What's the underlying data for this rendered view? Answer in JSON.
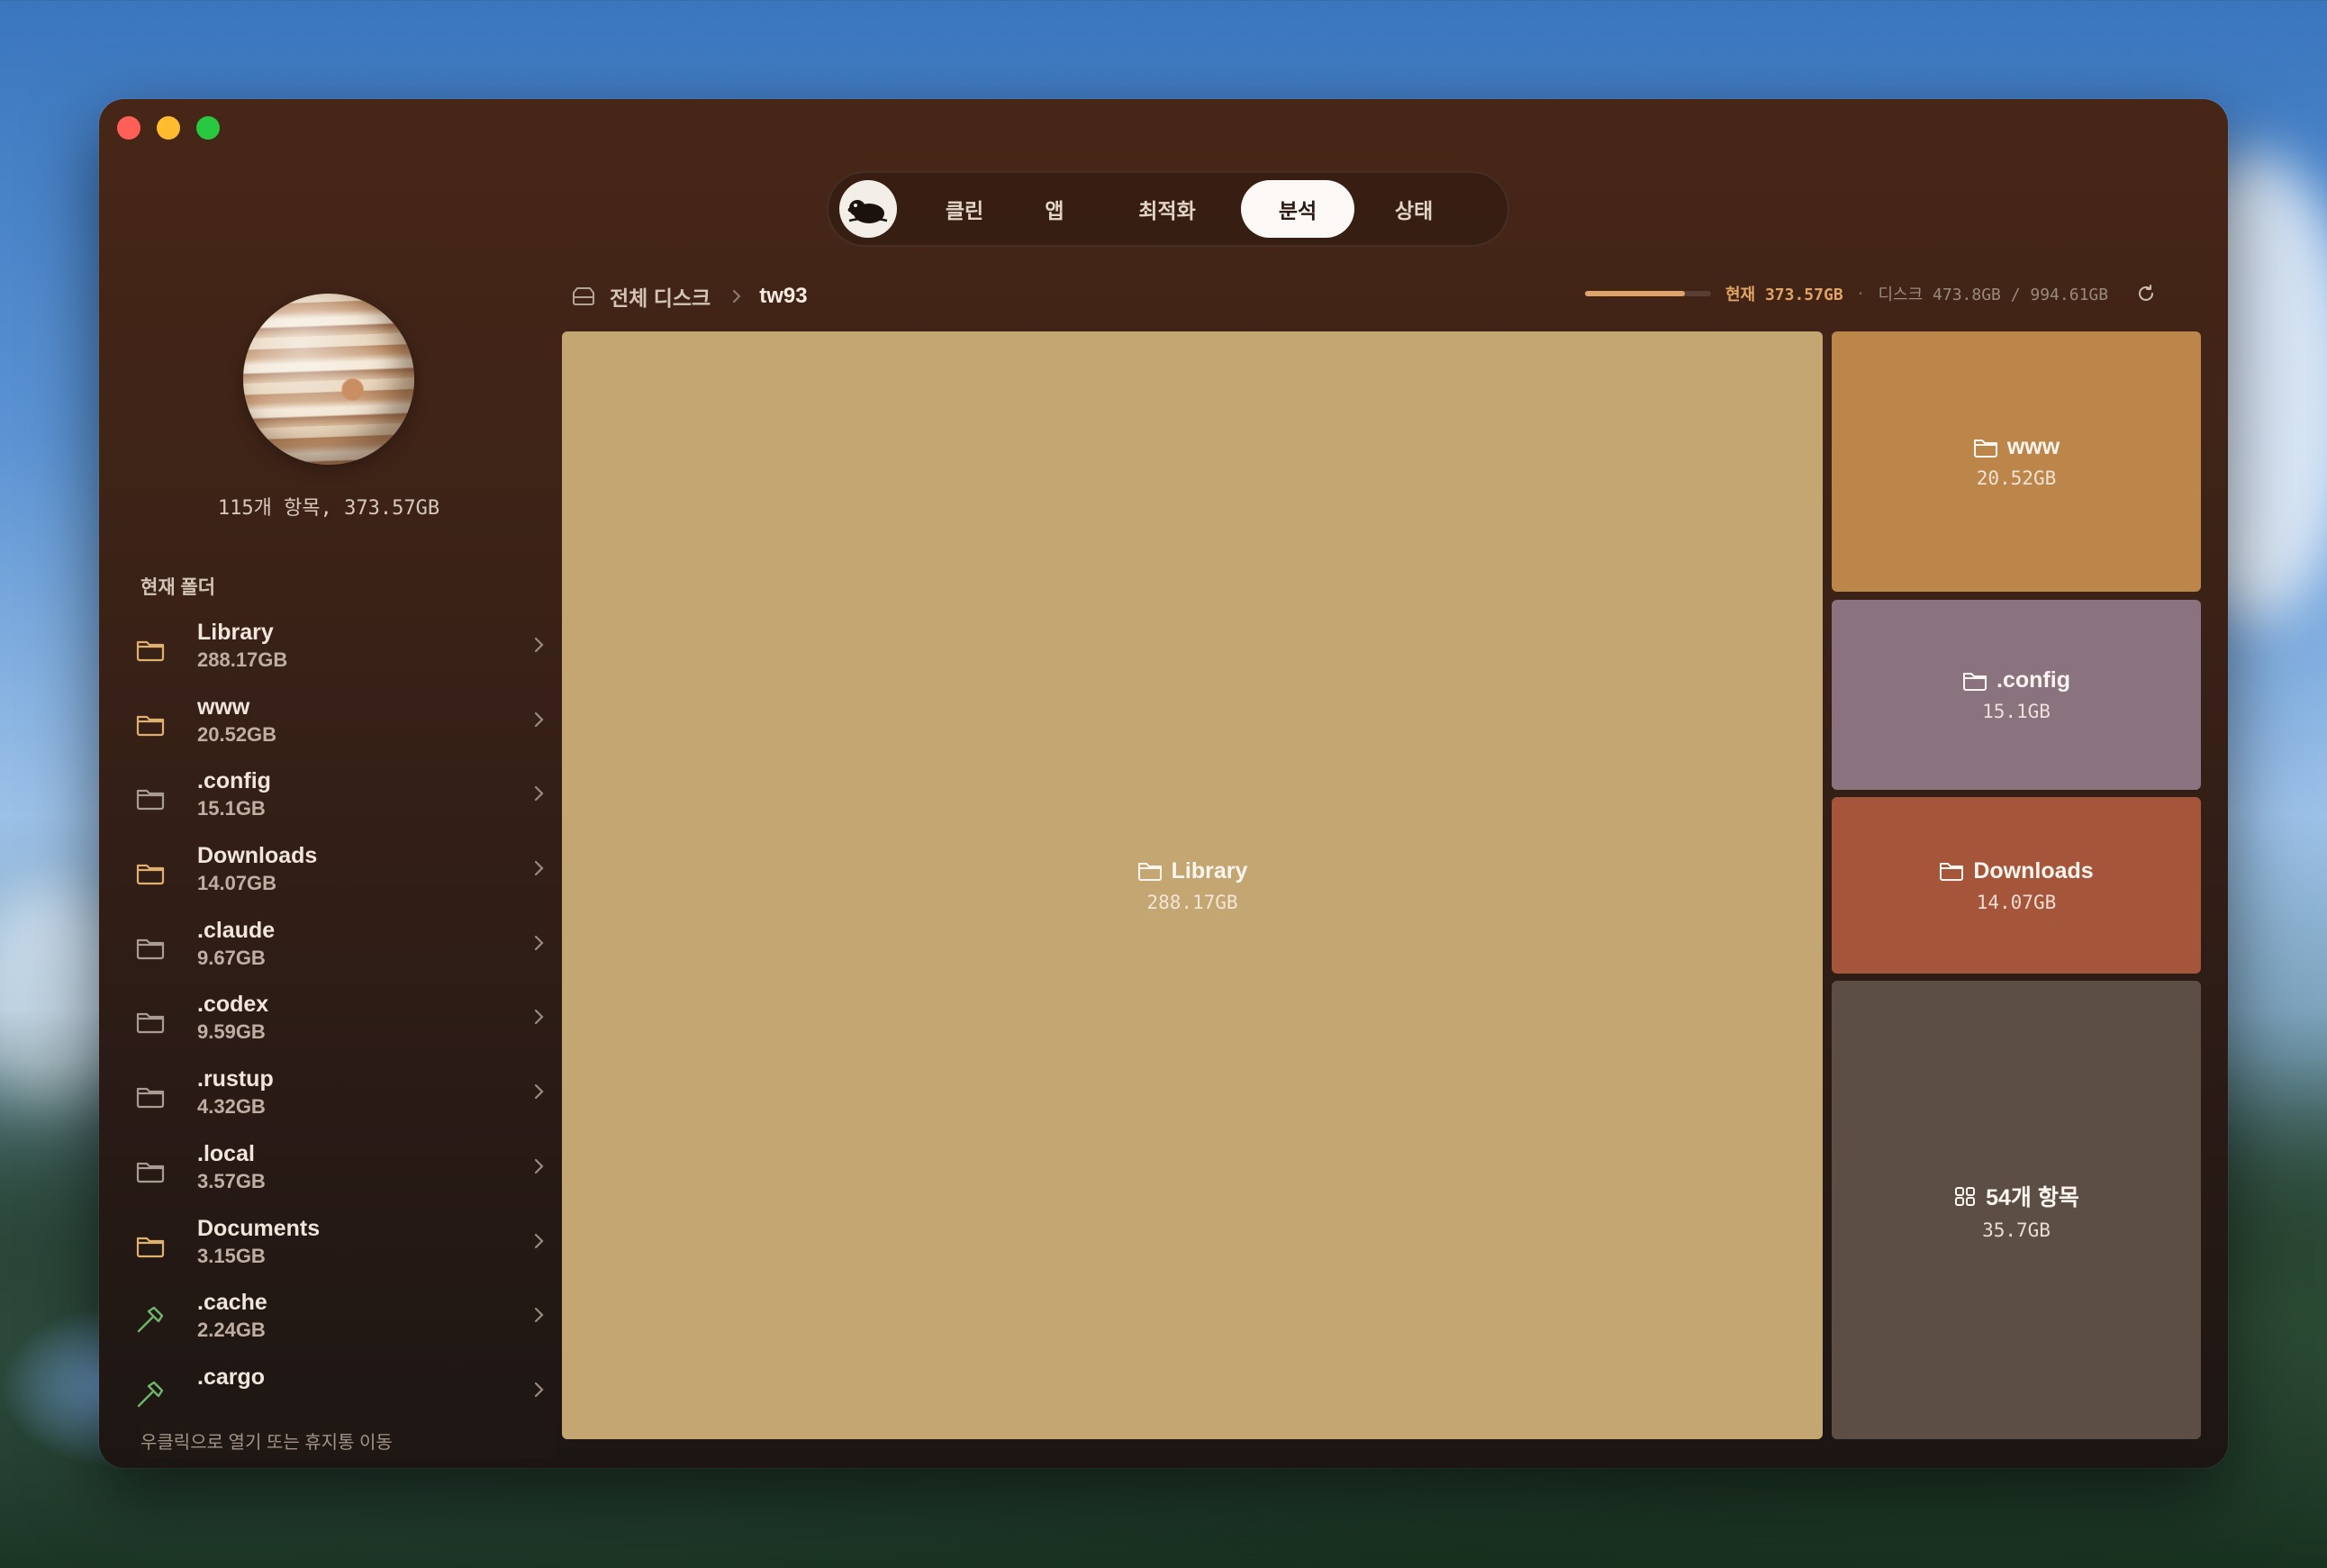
{
  "nav": {
    "tabs": [
      {
        "label": "클린"
      },
      {
        "label": "앱"
      },
      {
        "label": "최적화"
      },
      {
        "label": "분석"
      },
      {
        "label": "상태"
      }
    ],
    "active_tab": "분석"
  },
  "sidebar": {
    "summary": "115개 항목, 373.57GB",
    "section_title": "현재 폴더",
    "items": [
      {
        "name": "Library",
        "size": "288.17GB",
        "icon": "folder-icon",
        "accent": "#e0b06f"
      },
      {
        "name": "www",
        "size": "20.52GB",
        "icon": "folder-icon",
        "accent": "#e0b06f"
      },
      {
        "name": ".config",
        "size": "15.1GB",
        "icon": "folder-icon",
        "accent": "#a99c93"
      },
      {
        "name": "Downloads",
        "size": "14.07GB",
        "icon": "folder-icon",
        "accent": "#e0b06f"
      },
      {
        "name": ".claude",
        "size": "9.67GB",
        "icon": "folder-icon",
        "accent": "#a99c93"
      },
      {
        "name": ".codex",
        "size": "9.59GB",
        "icon": "folder-icon",
        "accent": "#a99c93"
      },
      {
        "name": ".rustup",
        "size": "4.32GB",
        "icon": "folder-icon",
        "accent": "#a99c93"
      },
      {
        "name": ".local",
        "size": "3.57GB",
        "icon": "folder-icon",
        "accent": "#a99c93"
      },
      {
        "name": "Documents",
        "size": "3.15GB",
        "icon": "folder-icon",
        "accent": "#e0b06f"
      },
      {
        "name": ".cache",
        "size": "2.24GB",
        "icon": "hammer-icon",
        "accent": "#6fb56a"
      },
      {
        "name": ".cargo",
        "size": "",
        "icon": "hammer-icon",
        "accent": "#6fb56a"
      }
    ],
    "footer_note": "우클릭으로 열기 또는 휴지통 이동"
  },
  "breadcrumb": {
    "root": "전체 디스크",
    "current": "tw93"
  },
  "usage": {
    "current": "현재 373.57GB",
    "separator": "·",
    "disk": "디스크 473.8GB / 994.61GB",
    "fill_fraction": 0.79
  },
  "treemap": {
    "tiles": [
      {
        "label": "Library",
        "size": "288.17GB",
        "icon": "folder-icon",
        "color": "#c4a672"
      },
      {
        "label": "www",
        "size": "20.52GB",
        "icon": "folder-icon",
        "color": "#bc864b"
      },
      {
        "label": ".config",
        "size": "15.1GB",
        "icon": "folder-icon",
        "color": "#8a727f"
      },
      {
        "label": "Downloads",
        "size": "14.07GB",
        "icon": "folder-icon",
        "color": "#a5553a"
      },
      {
        "label": "54개 항목",
        "size": "35.7GB",
        "icon": "grid-icon",
        "color": "#5d4e45"
      }
    ]
  },
  "colors": {
    "accent": "#e2a465",
    "window_top": "#472617",
    "window_bottom": "#1c1613"
  }
}
